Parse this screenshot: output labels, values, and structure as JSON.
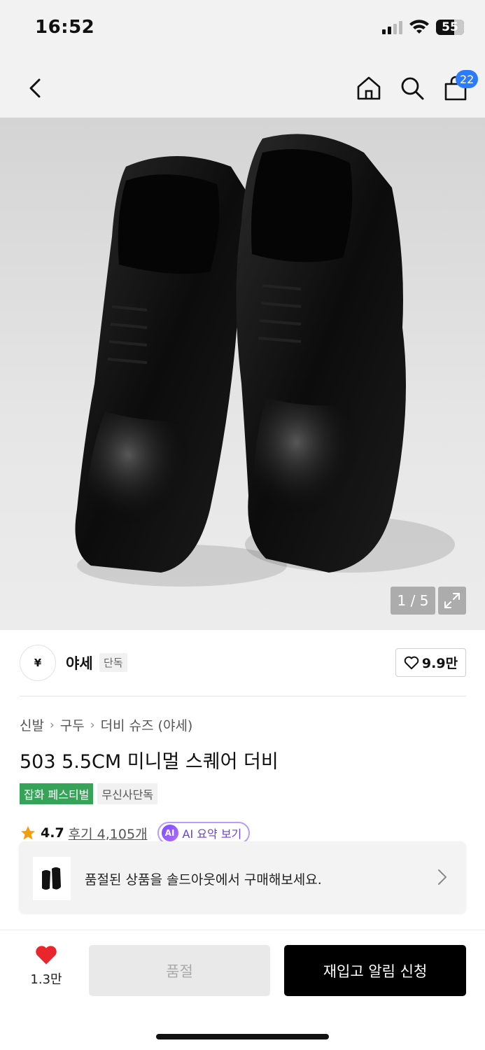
{
  "status": {
    "time": "16:52",
    "battery": "55"
  },
  "nav": {
    "cart_count": "22",
    "icons": [
      "back-icon",
      "home-icon",
      "search-icon",
      "cart-icon"
    ]
  },
  "gallery": {
    "counter": "1 / 5",
    "expand_icon": "expand-icon"
  },
  "brand": {
    "logo_text": "¥",
    "name": "야세",
    "tag": "단독",
    "likes": "9.9만"
  },
  "breadcrumb": [
    "신발",
    "구두",
    "더비 슈즈 (야세)"
  ],
  "product": {
    "title": "503 5.5CM 미니멀 스퀘어 더비",
    "tag_festival": "잡화 페스티벌",
    "tag_exclusive": "무신사단독"
  },
  "rating": {
    "score": "4.7",
    "reviews": "후기 4,105개",
    "ai_label": "AI 요약 보기",
    "ai_badge": "AI"
  },
  "banner": {
    "text": "품절된 상품을 솔드아웃에서 구매해보세요."
  },
  "bottom": {
    "heart_count": "1.3만",
    "soldout_label": "품절",
    "restock_label": "재입고 알림 신청"
  },
  "colors": {
    "accent_blue": "#2b7bff",
    "festival_green": "#36a458",
    "heart_red": "#e8262b",
    "ai_purple": "#6a3fe0"
  }
}
